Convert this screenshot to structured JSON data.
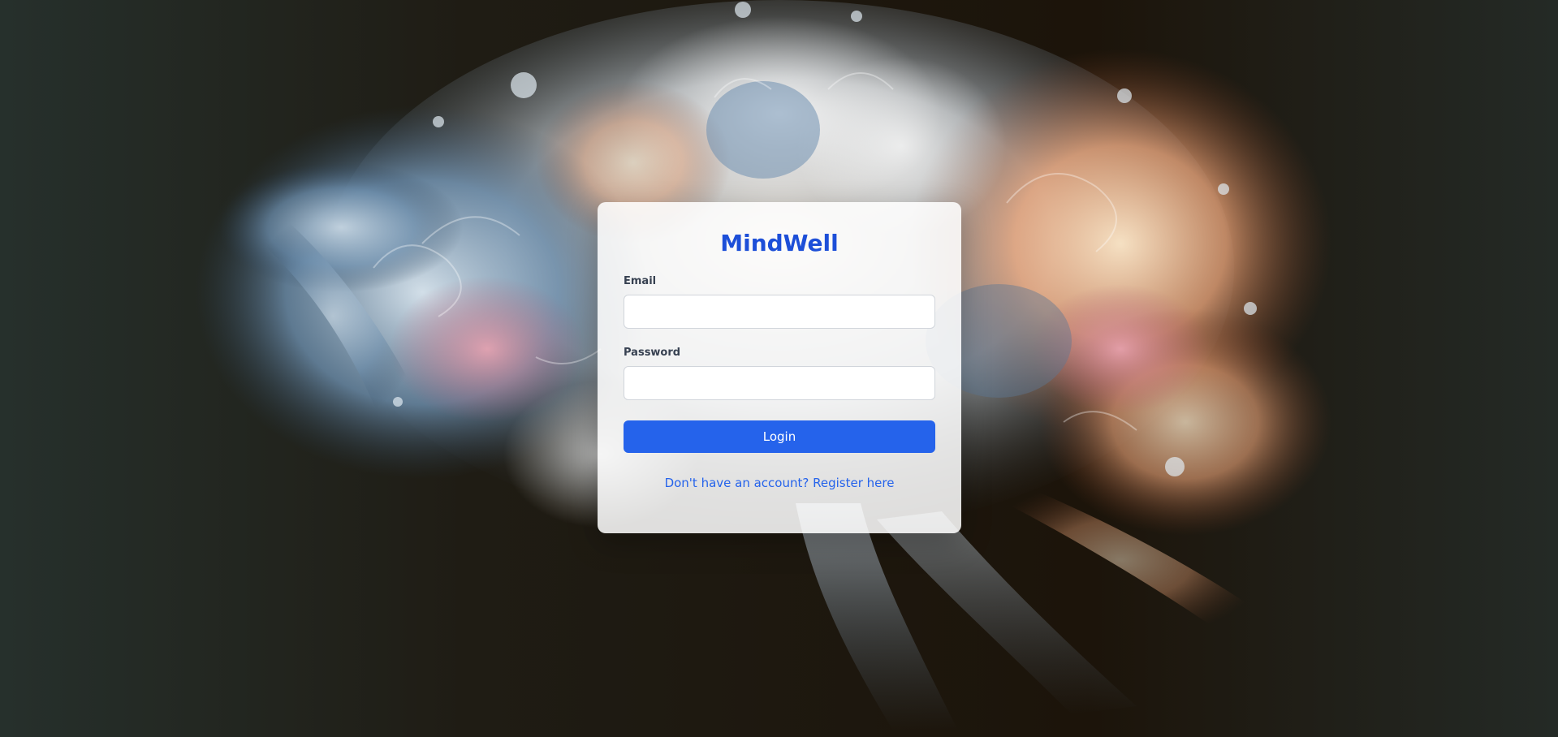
{
  "app": {
    "title": "MindWell"
  },
  "login_form": {
    "email_label": "Email",
    "email_value": "",
    "password_label": "Password",
    "password_value": "",
    "submit_label": "Login",
    "register_prompt": "Don't have an account? Register here"
  },
  "colors": {
    "brand": "#1d4fd8",
    "button": "#2563eb",
    "link": "#2563eb",
    "card_background": "rgba(255,255,255,0.86)"
  },
  "background": {
    "icon": "abstract-brain-art"
  }
}
